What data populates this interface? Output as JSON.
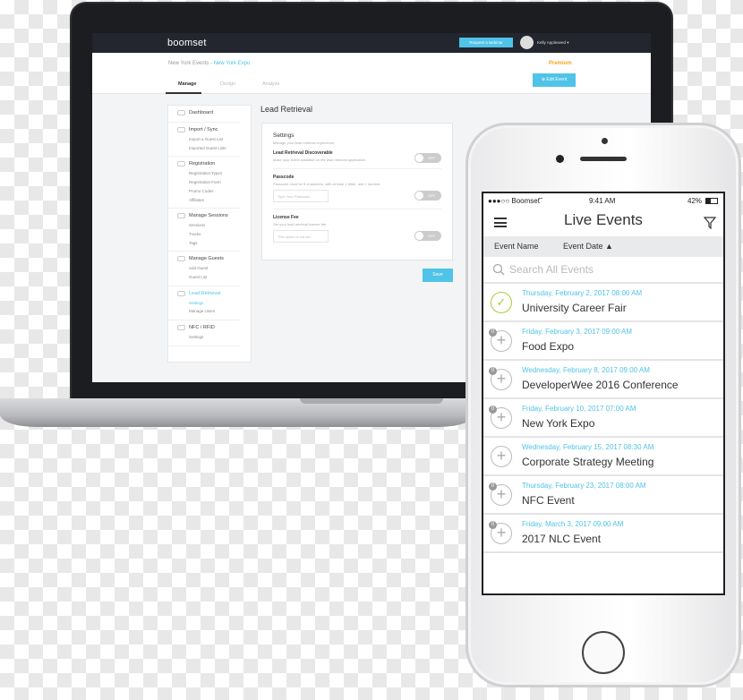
{
  "laptop": {
    "nav": {
      "logo": "boomset",
      "webinar_button": "Request a webinar",
      "user_name": "Kelly Appleseed ▾"
    },
    "breadcrumb": {
      "parent": "New York Events",
      "separator": " - ",
      "current": "New York Expo"
    },
    "plan_badge": "Premium",
    "tabs": [
      {
        "label": "Manage",
        "active": true
      },
      {
        "label": "Design"
      },
      {
        "label": "Analyze"
      }
    ],
    "edit_button": "⊕ Edit Event",
    "sidebar": [
      {
        "title": "Dashboard",
        "items": []
      },
      {
        "title": "Import / Sync",
        "items": [
          "Import a Guest List",
          "Imported Guest Lists"
        ]
      },
      {
        "title": "Registration",
        "items": [
          "Registration Types",
          "Registration Form",
          "Promo Codes",
          "Affiliates"
        ]
      },
      {
        "title": "Manage Sessions",
        "items": [
          "Sessions",
          "Tracks",
          "Tags"
        ]
      },
      {
        "title": "Manage Guests",
        "items": [
          "Add Guest",
          "Guest List"
        ]
      },
      {
        "title": "Lead Retrieval",
        "items": [
          "Settings",
          "Manage Users"
        ],
        "active": true
      },
      {
        "title": "NFC / RFID",
        "items": [
          "Settings"
        ]
      }
    ],
    "main_title": "Lead Retrieval",
    "settings": {
      "title": "Settings",
      "subtitle": "Manage your lead retrieval experience.",
      "discoverable": {
        "label": "Lead Retrieval Discoverable",
        "help": "Make your event available on the lead retrieval application.",
        "toggle": "OFF"
      },
      "passcode": {
        "label": "Passcode",
        "help": "Passcode must be 8 characters, with at least 1 letter, and 1 number.",
        "placeholder": "Type Your Passcode",
        "toggle": "OFF"
      },
      "license": {
        "label": "License Fee",
        "help": "Set your lead retrieval license fee.",
        "placeholder": "This option is not set",
        "toggle": "OFF"
      }
    },
    "save_button": "Save"
  },
  "phone": {
    "status": {
      "carrier": "●●●○○ Boomset",
      "time": "9:41 AM",
      "battery": "42%"
    },
    "title": "Live Events",
    "columns": [
      "Event Name",
      "Event Date ▲"
    ],
    "search_placeholder": "Search All Events",
    "accent": "#4fc3e8",
    "events": [
      {
        "date": "Thursday, February 2, 2017 08:00 AM",
        "name": "University Career Fair",
        "icon": "check-icon"
      },
      {
        "date": "Friday, February 3, 2017 09:00 AM",
        "name": "Food Expo",
        "icon": "plus-icon",
        "badge": "0"
      },
      {
        "date": "Wednesday, February 8, 2017 09:00 AM",
        "name": "DeveloperWee 2016 Conference",
        "icon": "plus-icon",
        "badge": "0"
      },
      {
        "date": "Friday, February 10, 2017 07:00 AM",
        "name": "New York Expo",
        "icon": "plus-icon",
        "badge": "0"
      },
      {
        "date": "Wednesday, February 15, 2017 08:30 AM",
        "name": "Corporate Strategy Meeting",
        "icon": "plus-icon"
      },
      {
        "date": "Thursday, February 23, 2017 08:00 AM",
        "name": "NFC Event",
        "icon": "plus-icon",
        "badge": "0"
      },
      {
        "date": "Friday, March 3, 2017 09:00 AM",
        "name": "2017 NLC Event",
        "icon": "plus-icon",
        "badge": "0"
      }
    ]
  }
}
